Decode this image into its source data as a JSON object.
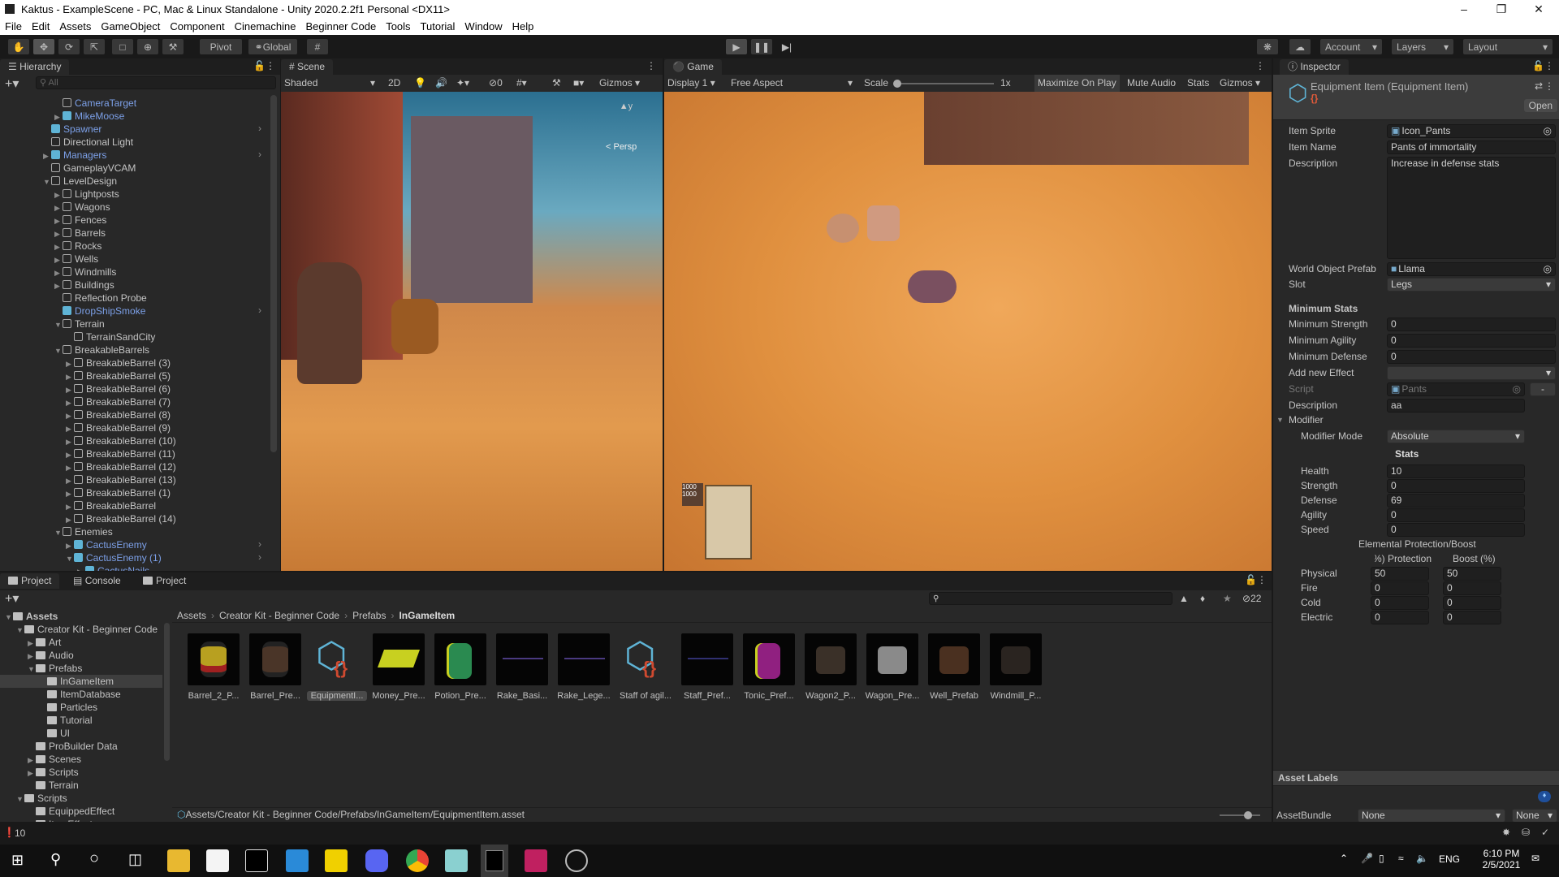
{
  "window": {
    "title": "Kaktus - ExampleScene - PC, Mac & Linux Standalone - Unity 2020.2.2f1 Personal <DX11>"
  },
  "menu": [
    "File",
    "Edit",
    "Assets",
    "GameObject",
    "Component",
    "Cinemachine",
    "Beginner Code",
    "Tools",
    "Tutorial",
    "Window",
    "Help"
  ],
  "toolbar": {
    "pivot": "Pivot",
    "global": "Global",
    "account": "Account",
    "layers": "Layers",
    "layout": "Layout"
  },
  "hierarchy": {
    "tab": "Hierarchy",
    "search_placeholder": "All",
    "items": [
      {
        "label": "CameraTarget",
        "level": 2,
        "arrow": "",
        "blue": true,
        "prefab": false,
        "chev": false
      },
      {
        "label": "MikeMoose",
        "level": 2,
        "arrow": "right",
        "blue": true,
        "prefab": true,
        "chev": false
      },
      {
        "label": "Spawner",
        "level": 1,
        "arrow": "",
        "blue": true,
        "prefab": true,
        "chev": true
      },
      {
        "label": "Directional Light",
        "level": 1,
        "arrow": "",
        "blue": false,
        "prefab": false,
        "chev": false
      },
      {
        "label": "Managers",
        "level": 1,
        "arrow": "right",
        "blue": true,
        "prefab": true,
        "chev": true
      },
      {
        "label": "GameplayVCAM",
        "level": 1,
        "arrow": "",
        "blue": false,
        "prefab": false,
        "chev": false
      },
      {
        "label": "LevelDesign",
        "level": 1,
        "arrow": "down",
        "blue": false,
        "prefab": false,
        "chev": false
      },
      {
        "label": "Lightposts",
        "level": 2,
        "arrow": "right",
        "blue": false,
        "prefab": false,
        "chev": false
      },
      {
        "label": "Wagons",
        "level": 2,
        "arrow": "right",
        "blue": false,
        "prefab": false,
        "chev": false
      },
      {
        "label": "Fences",
        "level": 2,
        "arrow": "right",
        "blue": false,
        "prefab": false,
        "chev": false
      },
      {
        "label": "Barrels",
        "level": 2,
        "arrow": "right",
        "blue": false,
        "prefab": false,
        "chev": false
      },
      {
        "label": "Rocks",
        "level": 2,
        "arrow": "right",
        "blue": false,
        "prefab": false,
        "chev": false
      },
      {
        "label": "Wells",
        "level": 2,
        "arrow": "right",
        "blue": false,
        "prefab": false,
        "chev": false
      },
      {
        "label": "Windmills",
        "level": 2,
        "arrow": "right",
        "blue": false,
        "prefab": false,
        "chev": false
      },
      {
        "label": "Buildings",
        "level": 2,
        "arrow": "right",
        "blue": false,
        "prefab": false,
        "chev": false
      },
      {
        "label": "Reflection Probe",
        "level": 2,
        "arrow": "",
        "blue": false,
        "prefab": false,
        "chev": false
      },
      {
        "label": "DropShipSmoke",
        "level": 2,
        "arrow": "",
        "blue": true,
        "prefab": true,
        "chev": true
      },
      {
        "label": "Terrain",
        "level": 2,
        "arrow": "down",
        "blue": false,
        "prefab": false,
        "chev": false
      },
      {
        "label": "TerrainSandCity",
        "level": 3,
        "arrow": "",
        "blue": false,
        "prefab": false,
        "chev": false
      },
      {
        "label": "BreakableBarrels",
        "level": 2,
        "arrow": "down",
        "blue": false,
        "prefab": false,
        "chev": false
      },
      {
        "label": "BreakableBarrel (3)",
        "level": 3,
        "arrow": "right",
        "blue": false,
        "prefab": false,
        "chev": false
      },
      {
        "label": "BreakableBarrel (5)",
        "level": 3,
        "arrow": "right",
        "blue": false,
        "prefab": false,
        "chev": false
      },
      {
        "label": "BreakableBarrel (6)",
        "level": 3,
        "arrow": "right",
        "blue": false,
        "prefab": false,
        "chev": false
      },
      {
        "label": "BreakableBarrel (7)",
        "level": 3,
        "arrow": "right",
        "blue": false,
        "prefab": false,
        "chev": false
      },
      {
        "label": "BreakableBarrel (8)",
        "level": 3,
        "arrow": "right",
        "blue": false,
        "prefab": false,
        "chev": false
      },
      {
        "label": "BreakableBarrel (9)",
        "level": 3,
        "arrow": "right",
        "blue": false,
        "prefab": false,
        "chev": false
      },
      {
        "label": "BreakableBarrel (10)",
        "level": 3,
        "arrow": "right",
        "blue": false,
        "prefab": false,
        "chev": false
      },
      {
        "label": "BreakableBarrel (11)",
        "level": 3,
        "arrow": "right",
        "blue": false,
        "prefab": false,
        "chev": false
      },
      {
        "label": "BreakableBarrel (12)",
        "level": 3,
        "arrow": "right",
        "blue": false,
        "prefab": false,
        "chev": false
      },
      {
        "label": "BreakableBarrel (13)",
        "level": 3,
        "arrow": "right",
        "blue": false,
        "prefab": false,
        "chev": false
      },
      {
        "label": "BreakableBarrel (1)",
        "level": 3,
        "arrow": "right",
        "blue": false,
        "prefab": false,
        "chev": false
      },
      {
        "label": "BreakableBarrel",
        "level": 3,
        "arrow": "right",
        "blue": false,
        "prefab": false,
        "chev": false
      },
      {
        "label": "BreakableBarrel (14)",
        "level": 3,
        "arrow": "right",
        "blue": false,
        "prefab": false,
        "chev": false
      },
      {
        "label": "Enemies",
        "level": 2,
        "arrow": "down",
        "blue": false,
        "prefab": false,
        "chev": false
      },
      {
        "label": "CactusEnemy",
        "level": 3,
        "arrow": "right",
        "blue": true,
        "prefab": true,
        "chev": true
      },
      {
        "label": "CactusEnemy (1)",
        "level": 3,
        "arrow": "down",
        "blue": true,
        "prefab": true,
        "chev": true
      },
      {
        "label": "CactusNails",
        "level": 4,
        "arrow": "right",
        "blue": true,
        "prefab": true,
        "chev": false
      }
    ]
  },
  "scene": {
    "tab": "Scene",
    "shading": "Shaded",
    "mode_2d": "2D",
    "hidden_count": "0",
    "gizmos": "Gizmos",
    "persp": "< Persp"
  },
  "game": {
    "tab": "Game",
    "display": "Display 1",
    "aspect": "Free Aspect",
    "scale_label": "Scale",
    "scale_value": "1x",
    "maximize": "Maximize On Play",
    "mute": "Mute Audio",
    "stats": "Stats",
    "gizmos": "Gizmos",
    "hud_a": "1000",
    "hud_b": "1000"
  },
  "project": {
    "tabs": [
      "Project",
      "Console",
      "Project"
    ],
    "tree": [
      {
        "label": "Assets",
        "level": 0,
        "arrow": "down",
        "bold": true,
        "open": true
      },
      {
        "label": "Creator Kit - Beginner Code",
        "level": 1,
        "arrow": "down",
        "open": true
      },
      {
        "label": "Art",
        "level": 2,
        "arrow": "right"
      },
      {
        "label": "Audio",
        "level": 2,
        "arrow": "right"
      },
      {
        "label": "Prefabs",
        "level": 2,
        "arrow": "down",
        "open": true
      },
      {
        "label": "InGameItem",
        "level": 3,
        "arrow": "",
        "selected": true
      },
      {
        "label": "ItemDatabase",
        "level": 3,
        "arrow": ""
      },
      {
        "label": "Particles",
        "level": 3,
        "arrow": ""
      },
      {
        "label": "Tutorial",
        "level": 3,
        "arrow": ""
      },
      {
        "label": "UI",
        "level": 3,
        "arrow": ""
      },
      {
        "label": "ProBuilder Data",
        "level": 2,
        "arrow": ""
      },
      {
        "label": "Scenes",
        "level": 2,
        "arrow": "right"
      },
      {
        "label": "Scripts",
        "level": 2,
        "arrow": "right"
      },
      {
        "label": "Terrain",
        "level": 2,
        "arrow": ""
      },
      {
        "label": "Scripts",
        "level": 1,
        "arrow": "down",
        "open": true
      },
      {
        "label": "EquippedEffect",
        "level": 2,
        "arrow": ""
      },
      {
        "label": "ItemEffect",
        "level": 2,
        "arrow": ""
      }
    ],
    "breadcrumb": [
      "Assets",
      "Creator Kit - Beginner Code",
      "Prefabs",
      "InGameItem"
    ],
    "hidden_count": "22",
    "assets": [
      {
        "label": "Barrel_2_P...",
        "kind": "barrel2",
        "color": "#b8a020"
      },
      {
        "label": "Barrel_Pre...",
        "kind": "barrel",
        "color": "#4a3528"
      },
      {
        "label": "EquipmentI...",
        "kind": "script",
        "selected": true
      },
      {
        "label": "Money_Pre...",
        "kind": "money",
        "color": "#c8d020"
      },
      {
        "label": "Potion_Pre...",
        "kind": "potion",
        "color": "#2a8a50"
      },
      {
        "label": "Rake_Basi...",
        "kind": "stick",
        "color": "#4a3a80"
      },
      {
        "label": "Rake_Lege...",
        "kind": "stick",
        "color": "#4a3a80"
      },
      {
        "label": "Staff of agil...",
        "kind": "script"
      },
      {
        "label": "Staff_Pref...",
        "kind": "stick",
        "color": "#303070"
      },
      {
        "label": "Tonic_Pref...",
        "kind": "potion",
        "color": "#902080"
      },
      {
        "label": "Wagon2_P...",
        "kind": "dim",
        "color": "#3a3028"
      },
      {
        "label": "Wagon_Pre...",
        "kind": "dim",
        "color": "#8a8a8a"
      },
      {
        "label": "Well_Prefab",
        "kind": "dim",
        "color": "#4a3020"
      },
      {
        "label": "Windmill_P...",
        "kind": "dim",
        "color": "#2a2420"
      }
    ],
    "path": "Assets/Creator Kit - Beginner Code/Prefabs/InGameItem/EquipmentItem.asset"
  },
  "inspector": {
    "tab": "Inspector",
    "title": "Equipment Item (Equipment Item)",
    "open": "Open",
    "item_sprite_label": "Item Sprite",
    "item_sprite": "Icon_Pants",
    "item_name_label": "Item Name",
    "item_name": "Pants of immortality",
    "description_label": "Description",
    "description": "Increase in defense stats",
    "world_prefab_label": "World Object Prefab",
    "world_prefab": "Llama",
    "slot_label": "Slot",
    "slot": "Legs",
    "min_stats": "Minimum Stats",
    "min_fields": [
      {
        "label": "Minimum Strength",
        "value": "0"
      },
      {
        "label": "Minimum Agility",
        "value": "0"
      },
      {
        "label": "Minimum Defense",
        "value": "0"
      }
    ],
    "add_effect_label": "Add new Effect",
    "add_effect": "",
    "script_label": "Script",
    "script": "Pants",
    "remove": "-",
    "effect_desc_label": "Description",
    "effect_desc": "aa",
    "modifier": "Modifier",
    "modifier_mode_label": "Modifier Mode",
    "modifier_mode": "Absolute",
    "stats_header": "Stats",
    "stats": [
      {
        "label": "Health",
        "value": "10"
      },
      {
        "label": "Strength",
        "value": "0"
      },
      {
        "label": "Defense",
        "value": "69"
      },
      {
        "label": "Agility",
        "value": "0"
      },
      {
        "label": "Speed",
        "value": "0"
      }
    ],
    "elemental_header": "Elemental Protection/Boost",
    "protection_header": "Protection (%",
    "boost_header": "Boost (%)",
    "elements": [
      {
        "label": "Physical",
        "protection": "50",
        "boost": "50"
      },
      {
        "label": "Fire",
        "protection": "0",
        "boost": "0"
      },
      {
        "label": "Cold",
        "protection": "0",
        "boost": "0"
      },
      {
        "label": "Electric",
        "protection": "0",
        "boost": "0"
      }
    ],
    "asset_labels": "Asset Labels",
    "asset_bundle_label": "AssetBundle",
    "asset_bundle": "None",
    "asset_variant": "None"
  },
  "status": {
    "count": "10"
  },
  "taskbar": {
    "lang": "ENG",
    "time": "6:10 PM",
    "date": "2/5/2021"
  }
}
